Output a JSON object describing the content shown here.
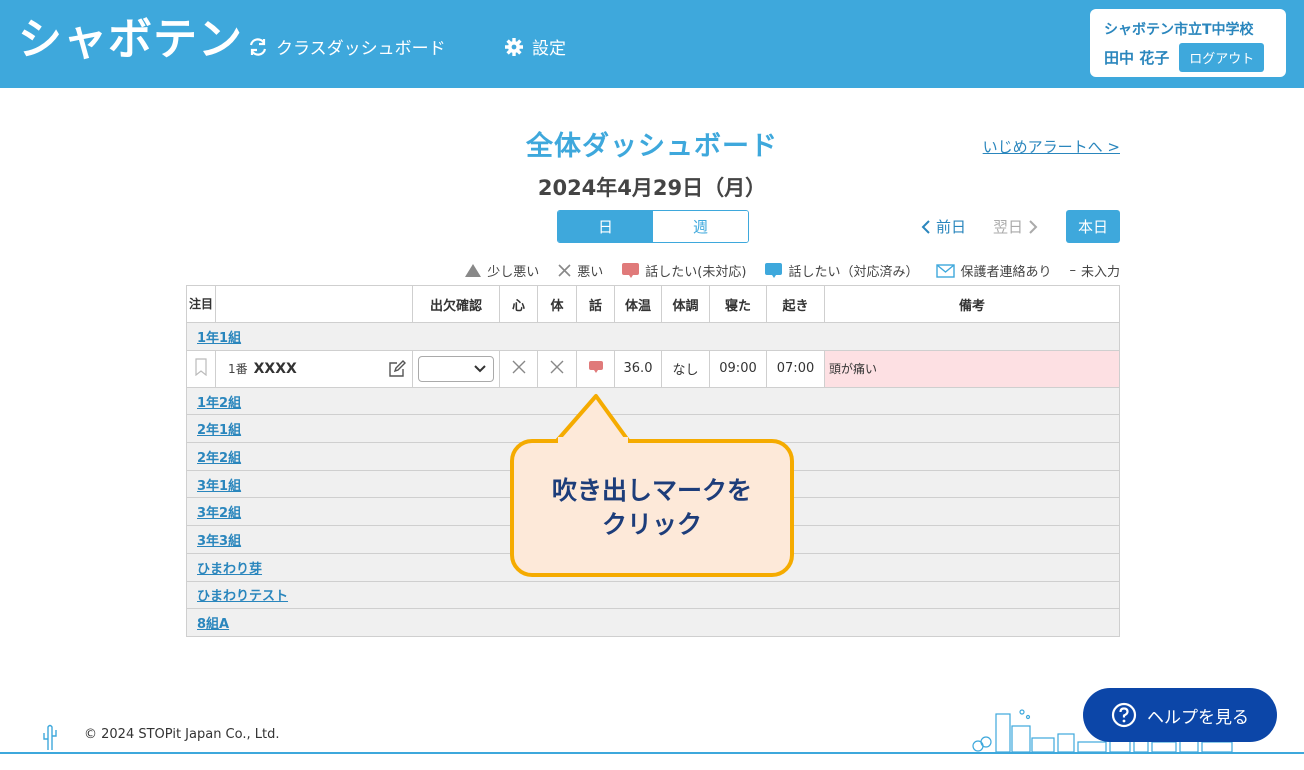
{
  "header": {
    "logo": "シャボテン",
    "nav": {
      "dashboard": "クラスダッシュボード",
      "settings": "設定"
    },
    "user": {
      "school": "シャボテン市立T中学校",
      "name": "田中 花子",
      "logout": "ログアウト"
    }
  },
  "page": {
    "title": "全体ダッシュボード",
    "bully_link": "いじめアラートへ >",
    "date": "2024年4月29日（月）",
    "toggle": {
      "day": "日",
      "week": "週"
    },
    "prev": "前日",
    "next": "翌日",
    "today": "本日"
  },
  "legend": {
    "slightly_bad": "少し悪い",
    "bad": "悪い",
    "talk_unhandled": "話したい(未対応)",
    "talk_handled": "話したい（対応済み）",
    "guardian": "保護者連絡あり",
    "none": "未入力",
    "none_mark": "–"
  },
  "table": {
    "headers": {
      "attention": "注目",
      "attendance": "出欠確認",
      "mind": "心",
      "body": "体",
      "talk": "話",
      "temp": "体温",
      "condition": "体調",
      "sleep": "寝た",
      "wake": "起き",
      "notes": "備考"
    },
    "groups": [
      "1年1組",
      "1年2組",
      "2年1組",
      "2年2組",
      "3年1組",
      "3年2組",
      "3年3組",
      "ひまわり芽",
      "ひまわりテスト",
      "8組A"
    ],
    "student": {
      "number": "1番",
      "name": "XXXX",
      "temp": "36.0",
      "condition": "なし",
      "sleep": "09:00",
      "wake": "07:00",
      "notes": "頭が痛い"
    }
  },
  "callout": {
    "line1": "吹き出しマークを",
    "line2": "クリック"
  },
  "footer": {
    "copyright": "© 2024 STOPit Japan Co., Ltd.",
    "help": "ヘルプを見る"
  },
  "colors": {
    "primary": "#3ea8dc",
    "callout_border": "#f5ab00",
    "callout_bg": "#fde9d9",
    "help_bg": "#0c46a8",
    "talk_unhandled": "#e07a7a"
  }
}
